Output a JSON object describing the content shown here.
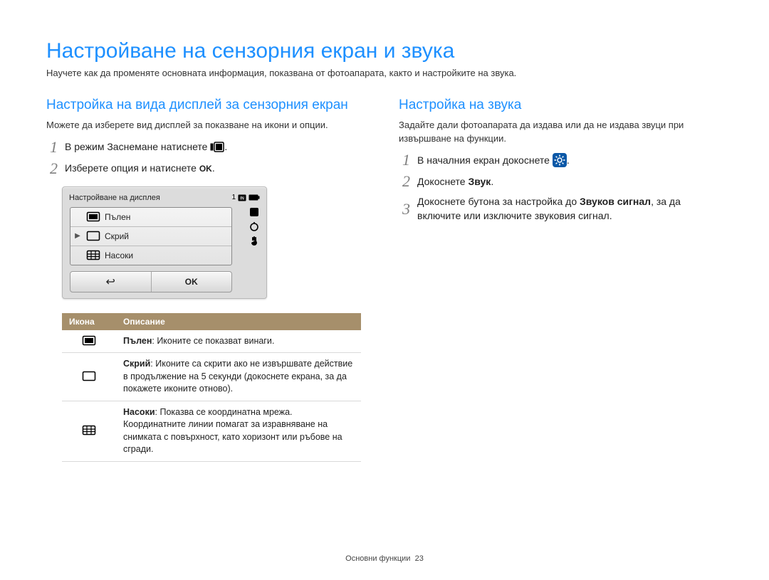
{
  "page": {
    "title": "Настройване на сензорния екран и звука",
    "intro": "Научете как да променяте основната информация, показвана от фотоапарата, както и настройките на звука."
  },
  "left": {
    "title": "Настройка на вида дисплей за сензорния екран",
    "desc": "Можете да изберете вид дисплей за показване на икони и опции.",
    "step1": "В режим Заснемане натиснете ",
    "step1_after": ".",
    "step2": "Изберете опция и натиснете ",
    "step2_after": "."
  },
  "camera": {
    "title": "Настройване на дисплея",
    "count": "1",
    "opt1": "Пълен",
    "opt2": "Скрий",
    "opt3": "Насоки",
    "ok": "OK"
  },
  "table": {
    "th1": "Икона",
    "th2": "Описание",
    "r1_name": "Пълен",
    "r1_text": ": Иконите се показват винаги.",
    "r2_name": "Скрий",
    "r2_text": ": Иконите са скрити ако не извършвате действие в продължение на 5 секунди (докоснете екрана, за да покажете иконите отново).",
    "r3_name": "Насоки",
    "r3_text": ": Показва се координатна мрежа. Координатните линии помагат за изравняване на снимката с повърхност, като хоризонт или ръбове на сгради."
  },
  "right": {
    "title": "Настройка на звука",
    "desc": "Задайте дали фотоапарата да издава или да не издава звуци при извършване на функции.",
    "step1": "В началния екран докоснете ",
    "step1_after": ".",
    "step2_pre": "Докоснете ",
    "step2_bold": "Звук",
    "step2_after": ".",
    "step3_pre": "Докоснете бутона за настройка до ",
    "step3_bold": "Звуков сигнал",
    "step3_after": ", за да включите или изключите звуковия сигнал."
  },
  "footer": {
    "section": "Основни функции",
    "page": "23"
  }
}
